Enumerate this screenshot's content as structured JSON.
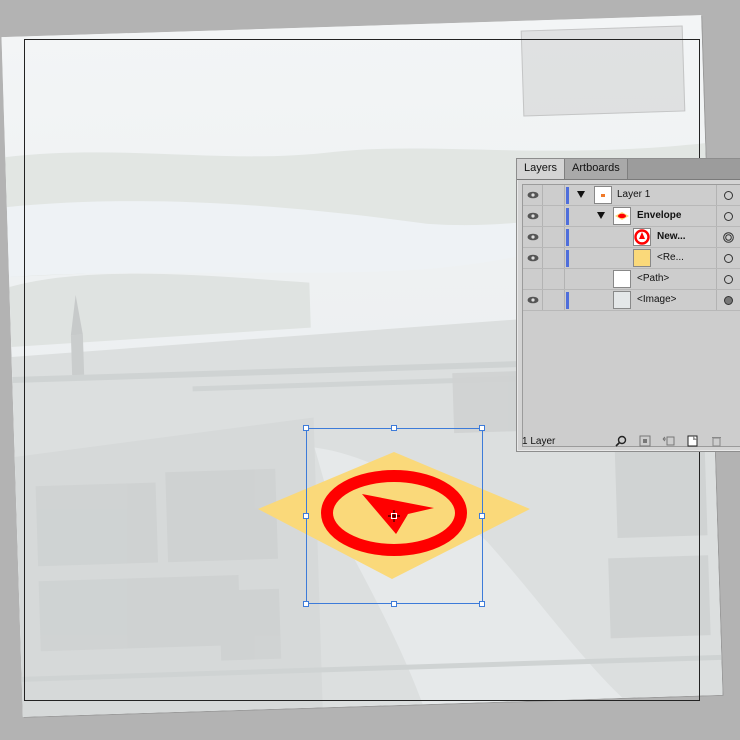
{
  "layers_panel": {
    "tabs": [
      {
        "label": "Layers",
        "active": true
      },
      {
        "label": "Artboards",
        "active": false
      }
    ],
    "rows": [
      {
        "name": "Layer 1",
        "visible": true,
        "expanded": true,
        "indent": 0
      },
      {
        "name": "Envelope",
        "visible": true,
        "expanded": true,
        "indent": 1
      },
      {
        "name": "New...",
        "visible": true,
        "expanded": false,
        "indent": 2,
        "targeted": true
      },
      {
        "name": "<Re...",
        "visible": true,
        "expanded": false,
        "indent": 2
      },
      {
        "name": "<Path>",
        "visible": false,
        "expanded": false,
        "indent": 1
      },
      {
        "name": "<Image>",
        "visible": true,
        "expanded": false,
        "indent": 1,
        "target_filled": true
      }
    ],
    "footer_label": "1 Layer",
    "footer_icons": [
      "locate-object-icon",
      "make-clipping-mask-icon",
      "create-sublayer-icon",
      "new-layer-icon",
      "delete-icon"
    ]
  },
  "colors": {
    "envelope_fill": "#fad97a",
    "symbol_red": "#ff0000",
    "selection": "#3d7bd9",
    "layer_color": "#4f6edb"
  }
}
